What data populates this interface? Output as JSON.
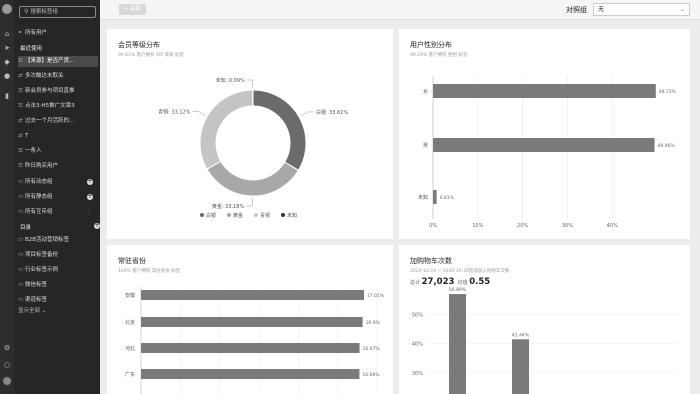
{
  "sidebar": {
    "search_placeholder": "搜索标签组",
    "all_users": "所有用户",
    "recent_header": "最近使用",
    "recent_items": [
      "【来源】是否产货...",
      "多次触达未取关",
      "新会员参与项目直推",
      "点击3-H5推广文章3",
      "过去一个月活跃的...",
      "T",
      "一条人",
      "昨日购买用户"
    ],
    "groups": [
      "所有动态组",
      "所有静态组",
      "所有互斥组"
    ],
    "dir_header": "目录",
    "dir_items": [
      "B2B活动营销标签",
      "项目标签备份",
      "行业标签示例",
      "微信标签",
      "渠道标签"
    ],
    "show_all": "显示全部"
  },
  "topbar": {
    "back_label": "返回",
    "compare_label": "对照组",
    "compare_value": "无"
  },
  "cards": {
    "member_level": {
      "title": "会员等级分布",
      "subtitle": "99.61% 客户拥有 VIP 等级 标签"
    },
    "gender": {
      "title": "用户性别分布",
      "subtitle": "89.19% 客户拥有 性别 标签"
    },
    "province": {
      "title": "常驻省份",
      "subtitle": "100% 客户拥有 常驻省份 标签"
    },
    "cart": {
      "title": "加购物车次数",
      "subtitle": "2020-10-24 ~ 2020-10-30完成加入购物车次数",
      "total_label": "总计",
      "total_value": "27,023",
      "avg_label": "均值",
      "avg_value": "0.55"
    }
  },
  "chart_data": [
    {
      "type": "pie",
      "title": "会员等级分布",
      "categories": [
        "白银",
        "黄金",
        "青铜",
        "未知"
      ],
      "values": [
        33.61,
        33.18,
        33.12,
        0.09
      ],
      "slice_labels": [
        "白银: 33.61%",
        "黄金: 33.18%",
        "青铜: 33.12%",
        "未知: 0.09%"
      ],
      "colors": [
        "#6b6b6b",
        "#a8a8a8",
        "#c4c4c4",
        "#333333"
      ],
      "legend": "bottom"
    },
    {
      "type": "bar",
      "orientation": "horizontal",
      "title": "用户性别分布",
      "categories": [
        "女",
        "男",
        "未知"
      ],
      "values": [
        49.73,
        49.46,
        0.81
      ],
      "value_labels": [
        "49.73%",
        "49.46%",
        "0.81%"
      ],
      "x_ticks": [
        "0%",
        "10%",
        "20%",
        "30%",
        "40%"
      ],
      "xlim": [
        0,
        50
      ],
      "color": "#7a7a7a"
    },
    {
      "type": "bar",
      "orientation": "horizontal",
      "title": "常驻省份",
      "categories": [
        "安徽",
        "北京",
        "河北",
        "广东"
      ],
      "values": [
        17.01,
        16.9,
        16.67,
        16.66
      ],
      "value_labels": [
        "17.01%",
        "16.9%",
        "16.67%",
        "16.66%"
      ],
      "xlim": [
        0,
        18
      ],
      "color": "#7a7a7a"
    },
    {
      "type": "bar",
      "title": "加购物车次数",
      "values": [
        56.89,
        41.44
      ],
      "value_labels": [
        "56.89%",
        "41.44%"
      ],
      "y_ticks": [
        "20%",
        "30%",
        "40%",
        "50%"
      ],
      "ylim": [
        20,
        60
      ],
      "color": "#7a7a7a"
    }
  ]
}
